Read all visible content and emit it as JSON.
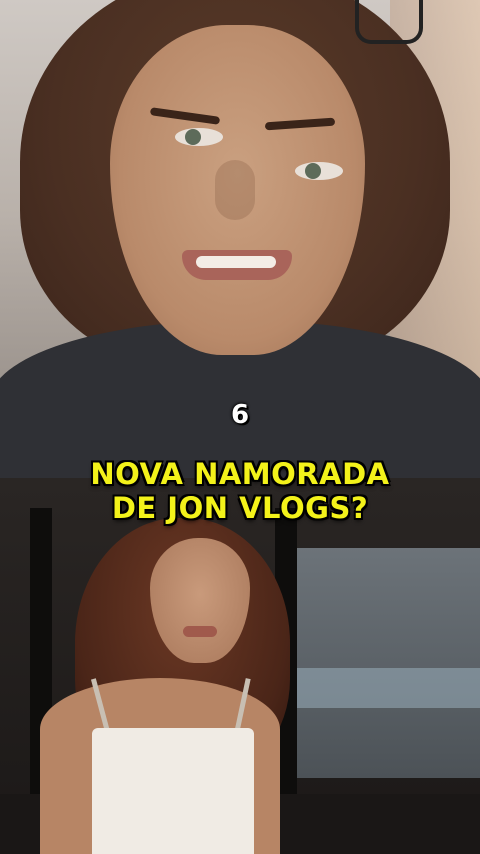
{
  "overlay": {
    "number": "6",
    "headline_line1": "NOVA NAMORADA",
    "headline_line2": "DE JON VLOGS?"
  },
  "colors": {
    "headline": "#f3f21a",
    "number": "#ffffff"
  }
}
